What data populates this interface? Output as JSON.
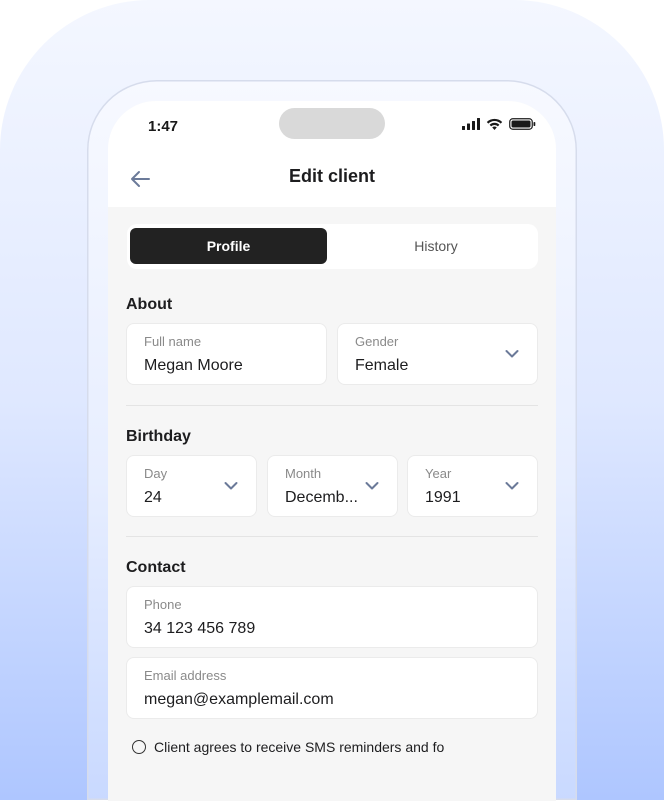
{
  "status_bar": {
    "time": "1:47"
  },
  "nav": {
    "title": "Edit client"
  },
  "tabs": [
    {
      "label": "Profile",
      "active": true
    },
    {
      "label": "History",
      "active": false
    }
  ],
  "about": {
    "title": "About",
    "full_name": {
      "label": "Full name",
      "value": "Megan Moore"
    },
    "gender": {
      "label": "Gender",
      "value": "Female"
    }
  },
  "birthday": {
    "title": "Birthday",
    "day": {
      "label": "Day",
      "value": "24"
    },
    "month": {
      "label": "Month",
      "value": "Decemb..."
    },
    "year": {
      "label": "Year",
      "value": "1991"
    }
  },
  "contact": {
    "title": "Contact",
    "phone": {
      "label": "Phone",
      "value": "34 123 456 789"
    },
    "email": {
      "label": "Email address",
      "value": "megan@examplemail.com"
    },
    "sms_consent": "Client agrees to receive SMS reminders and fo"
  },
  "colors": {
    "active_tab_bg": "#222222",
    "accent_chevron": "#6b7a99",
    "backdrop_bottom": "#aec6ff"
  }
}
